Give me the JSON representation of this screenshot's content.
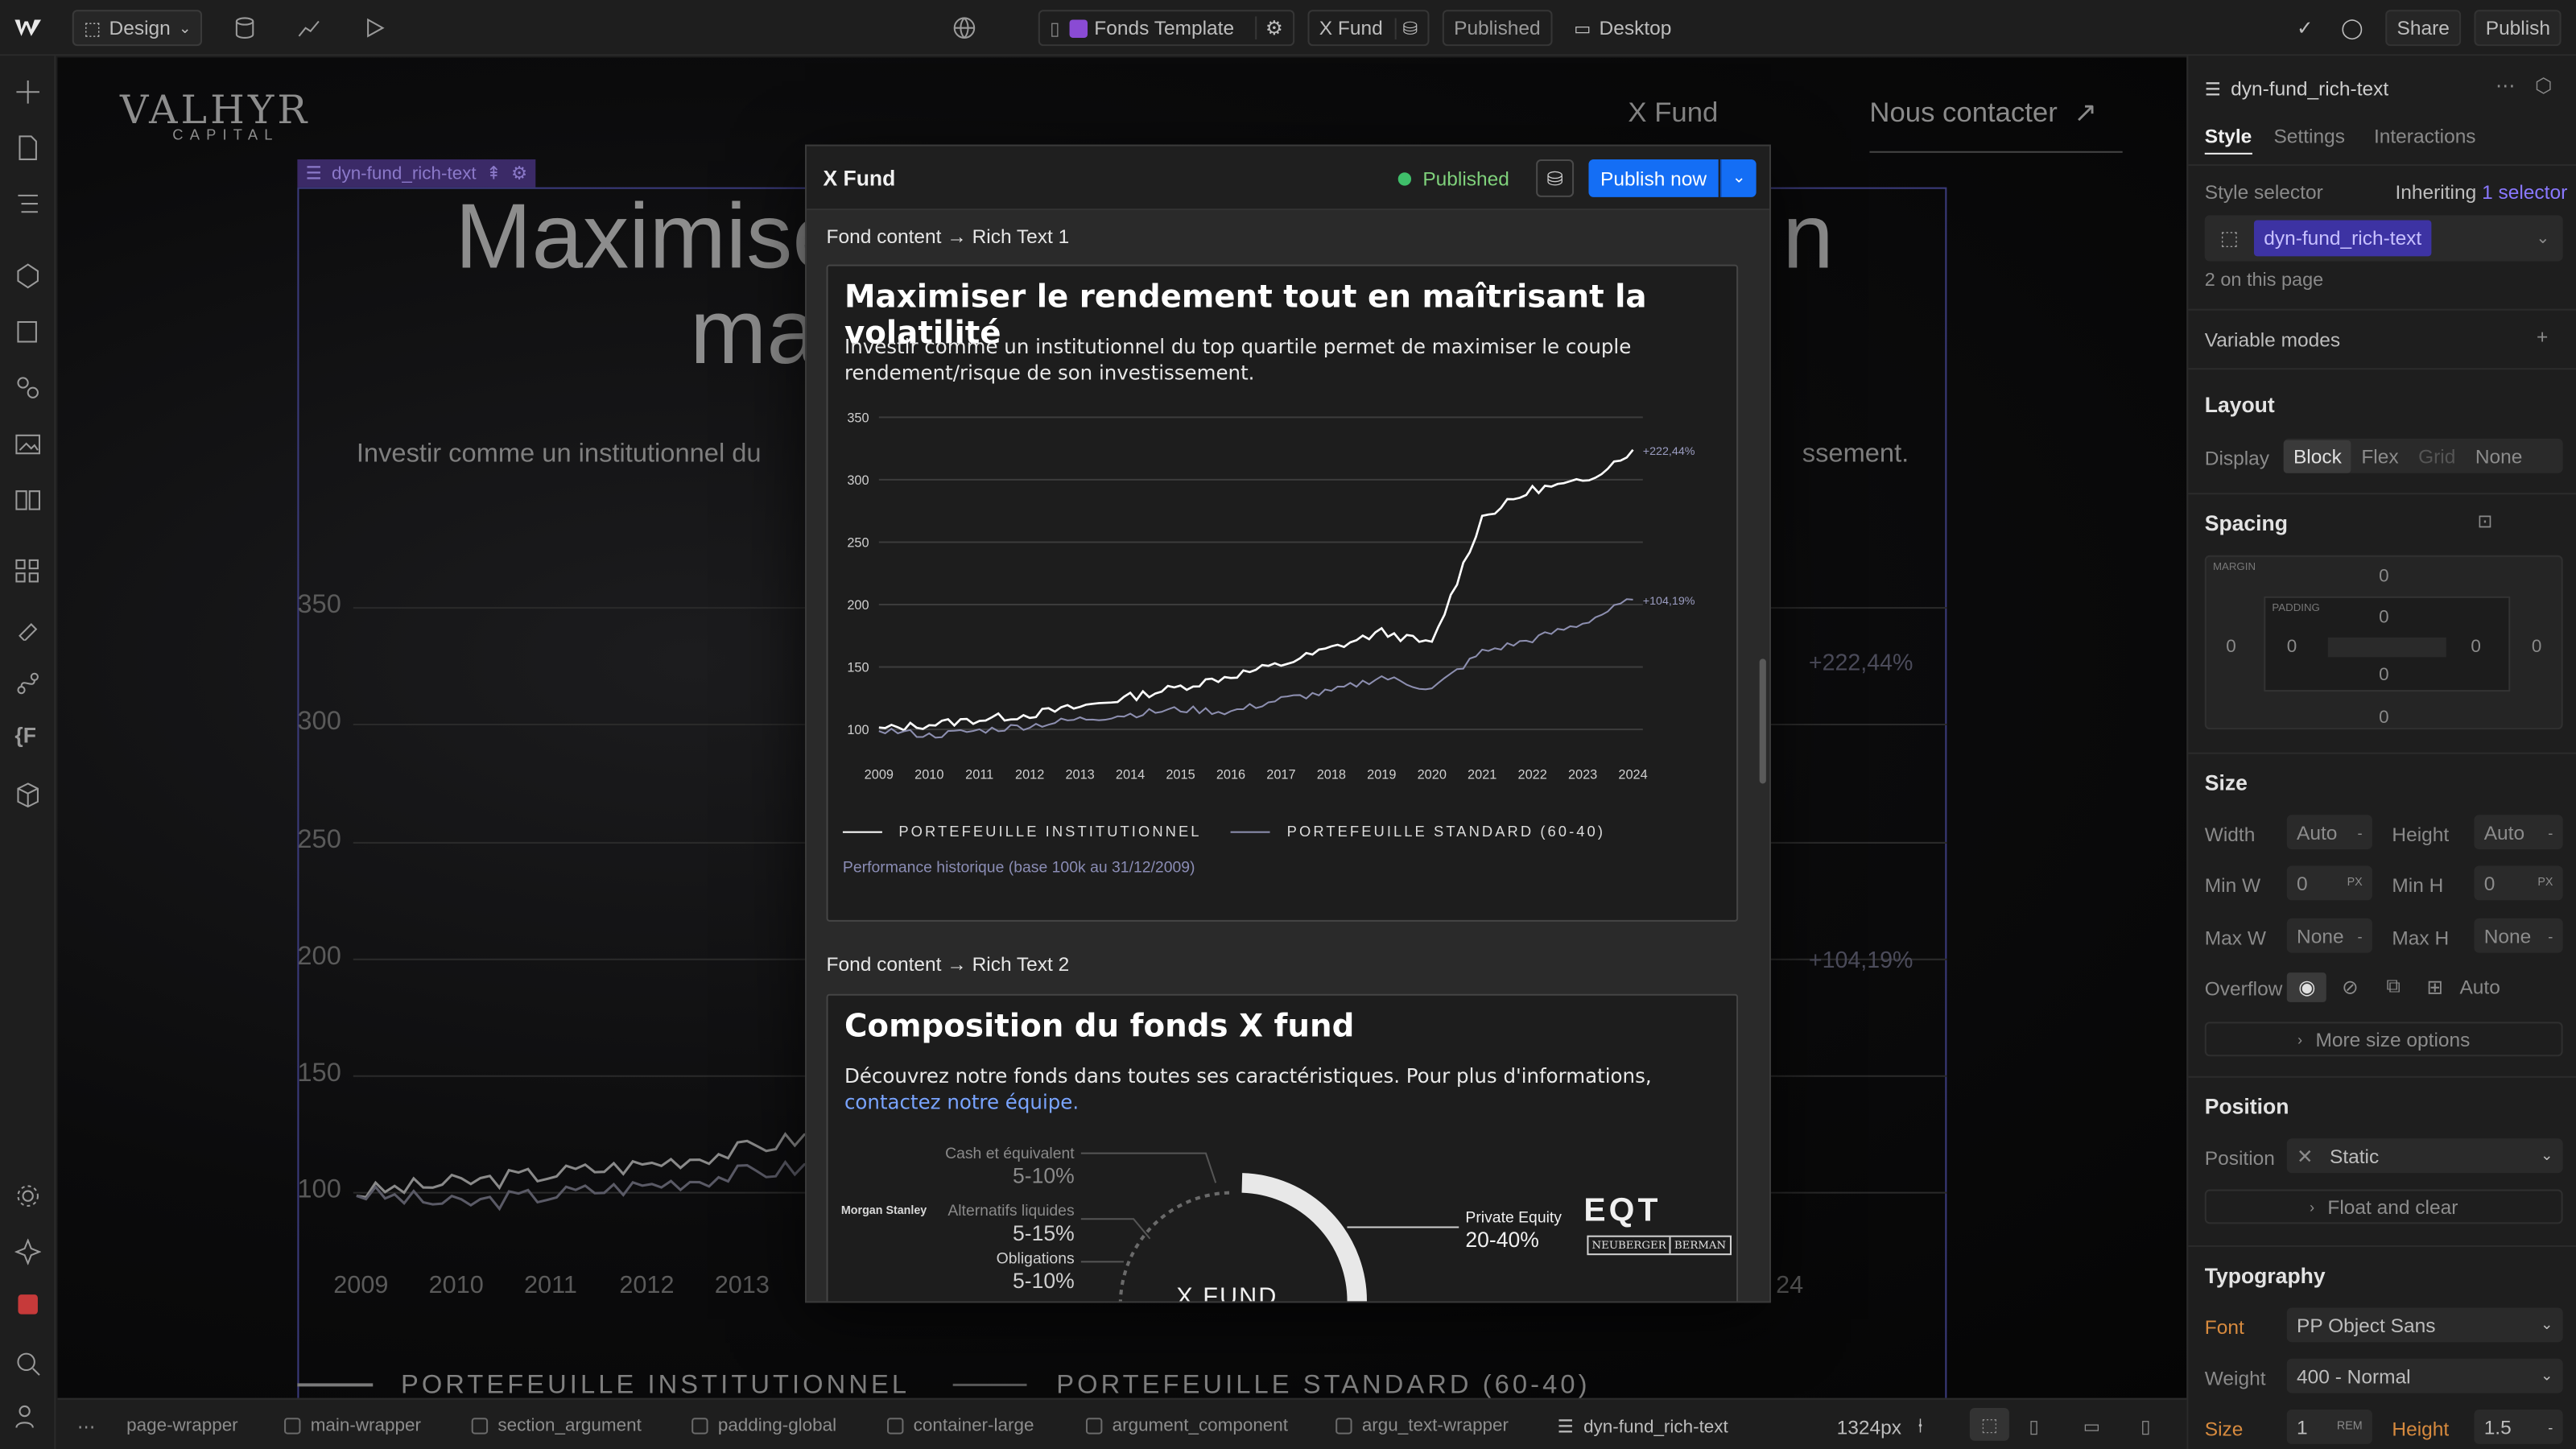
{
  "topbar": {
    "mode": "Design",
    "page": "Fonds Template",
    "collection": "X Fund",
    "status": "Published",
    "device": "Desktop",
    "share": "Share",
    "publish": "Publish"
  },
  "canvas": {
    "logo": "VALHYR",
    "logo_sub": "CAPITAL",
    "nav": [
      "X Fund",
      "Nous contacter"
    ],
    "selected_class": "dyn-fund_rich-text",
    "heading_line1": "Maximise",
    "heading_line1_right": "n",
    "heading_line2": "ma",
    "paragraph_left": "Investir comme un institutionnel du",
    "paragraph_right": "ssement.",
    "yticks": [
      "350",
      "300",
      "250",
      "200",
      "150",
      "100"
    ],
    "xticks": [
      "2009",
      "2010",
      "2011",
      "2012",
      "2013"
    ],
    "xtick_right": "24",
    "inst_value": "+222,44%",
    "std_value": "+104,19%",
    "legend_inst": "PORTEFEUILLE INSTITUTIONNEL",
    "legend_std": "PORTEFEUILLE STANDARD (60-40)"
  },
  "modal": {
    "title": "X Fund",
    "status": "Published",
    "publish_now": "Publish now",
    "field1_label": "Fond content → Rich Text 1",
    "rt1_title": "Maximiser le rendement tout en maîtrisant la volatilité",
    "rt1_body": "Investir comme un institutionnel du top quartile permet de maximiser le couple rendement/risque de son investissement.",
    "rt1_caption": "Performance historique (base 100k au 31/12/2009)",
    "field2_label": "Fond content → Rich Text 2",
    "rt2_title": "Composition du fonds X fund",
    "rt2_body": "Découvrez notre fonds dans toutes ses caractéristiques. Pour plus d'informations, ",
    "rt2_link": "contactez notre équipe.",
    "donut_center": "X FUND",
    "alloc": [
      {
        "label": "Cash et équivalent",
        "pct": "5-10%"
      },
      {
        "label": "Alternatifs liquides",
        "pct": "5-15%"
      },
      {
        "label": "Obligations",
        "pct": "5-10%"
      },
      {
        "label": "Private Equity",
        "pct": "20-40%"
      }
    ],
    "logo_ms": "Morgan Stanley",
    "logo_eqt": "EQT",
    "logo_nb1": "NEUBERGER",
    "logo_nb2": "BERMAN"
  },
  "right_panel": {
    "element": "dyn-fund_rich-text",
    "tabs": [
      "Style",
      "Settings",
      "Interactions"
    ],
    "style_selector": "Style selector",
    "inheriting": "Inheriting",
    "inheriting_count": "1 selector",
    "selector_chip": "dyn-fund_rich-text",
    "on_page": "2 on this page",
    "variable_modes": "Variable modes",
    "layout": "Layout",
    "display": "Display",
    "display_opts": [
      "Block",
      "Flex",
      "Grid",
      "None"
    ],
    "spacing": "Spacing",
    "margin": "MARGIN",
    "padding": "PADDING",
    "zero": "0",
    "size": "Size",
    "width": "Width",
    "height": "Height",
    "auto": "Auto",
    "minw": "Min W",
    "minh": "Min H",
    "px": "PX",
    "maxw": "Max W",
    "maxh": "Max H",
    "none": "None",
    "overflow": "Overflow",
    "more_size": "More size options",
    "position": "Position",
    "position_val": "Static",
    "float_clear": "Float and clear",
    "typography": "Typography",
    "font": "Font",
    "font_val": "PP Object Sans",
    "weight": "Weight",
    "weight_val": "400 - Normal",
    "sizel": "Size",
    "size_val": "1",
    "rem": "REM",
    "lh": "Height",
    "lh_val": "1.5"
  },
  "breadcrumbs": [
    "page-wrapper",
    "main-wrapper",
    "section_argument",
    "padding-global",
    "container-large",
    "argument_component",
    "argu_text-wrapper",
    "dyn-fund_rich-text"
  ],
  "viewport": "1324px",
  "chart_data": {
    "type": "line",
    "x": [
      2009,
      2010,
      2011,
      2012,
      2013,
      2014,
      2015,
      2016,
      2017,
      2018,
      2019,
      2020,
      2021,
      2022,
      2023,
      2024
    ],
    "series": [
      {
        "name": "PORTEFEUILLE INSTITUTIONNEL",
        "values": [
          100,
          104,
          108,
          112,
          118,
          126,
          134,
          143,
          152,
          165,
          178,
          168,
          270,
          292,
          298,
          324
        ]
      },
      {
        "name": "PORTEFEUILLE STANDARD (60-40)",
        "values": [
          100,
          95,
          99,
          103,
          108,
          112,
          116,
          114,
          124,
          130,
          142,
          132,
          162,
          172,
          185,
          204
        ]
      }
    ],
    "ylim": [
      100,
      350
    ],
    "yticks": [
      100,
      150,
      200,
      250,
      300,
      350
    ],
    "end_labels": [
      "+222,44%",
      "+104,19%"
    ],
    "colors": {
      "inst": "#ffffff",
      "std": "#8d8fb0"
    }
  }
}
